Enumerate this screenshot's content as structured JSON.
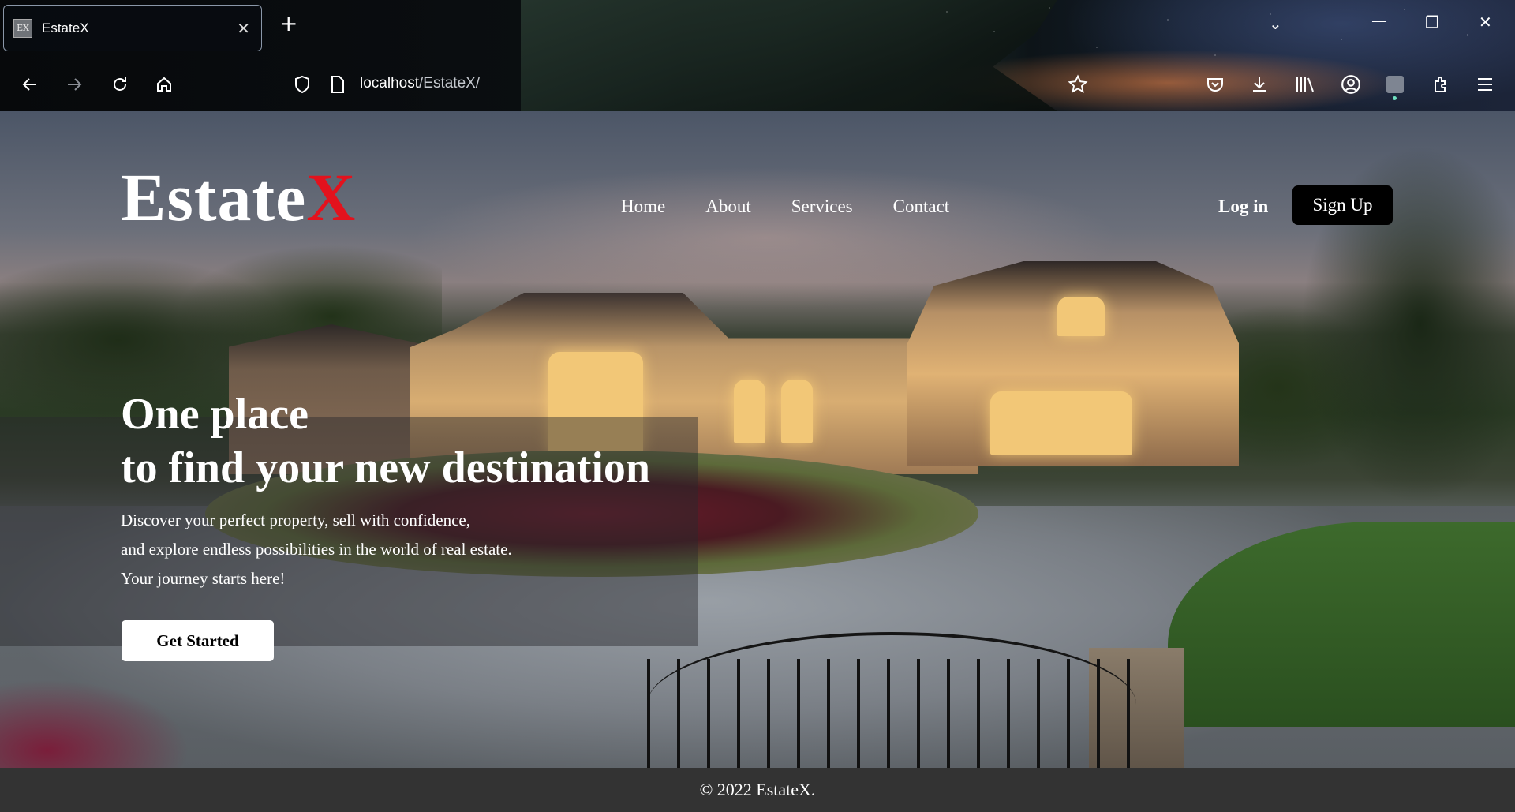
{
  "browser": {
    "tab": {
      "favicon_text": "EX",
      "title": "EstateX",
      "close_glyph": "✕"
    },
    "new_tab_glyph": "+",
    "url": {
      "host": "localhost",
      "path": "/EstateX/"
    },
    "window_controls": {
      "list_glyph": "⌄",
      "minimize_glyph": "—",
      "restore_glyph": "❐",
      "close_glyph": "✕"
    },
    "nav_icons": [
      "back-icon",
      "forward-icon",
      "reload-icon",
      "home-icon",
      "shield-icon",
      "page-icon",
      "bookmark-star-icon",
      "pocket-icon",
      "download-icon",
      "library-icon",
      "account-icon",
      "extension-icon",
      "puzzle-icon",
      "menu-icon"
    ]
  },
  "site": {
    "logo": {
      "main": "Estate",
      "accent": "X",
      "accent_color": "#e3121d"
    },
    "nav": [
      {
        "label": "Home"
      },
      {
        "label": "About"
      },
      {
        "label": "Services"
      },
      {
        "label": "Contact"
      }
    ],
    "login_label": "Log in",
    "signup_label": "Sign Up",
    "hero": {
      "title_line1": "One place",
      "title_line2": "to find your new destination",
      "text_line1": "Discover your perfect property, sell with confidence,",
      "text_line2": "and explore endless possibilities in the world of real estate.",
      "text_line3": "Your journey starts here!",
      "cta_label": "Get Started"
    },
    "footer": "© 2022 EstateX."
  }
}
